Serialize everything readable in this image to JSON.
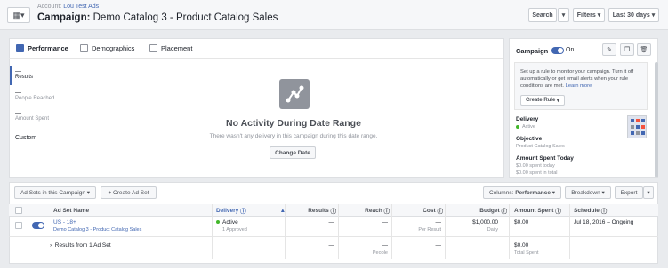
{
  "header": {
    "account_prefix": "Account:",
    "account_name": "Lou Test Ads",
    "title_type": "Campaign:",
    "title_name": "Demo Catalog 3 - Product Catalog Sales",
    "search_label": "Search",
    "filters_label": "Filters",
    "date_label": "Last 30 days"
  },
  "tabs": [
    {
      "label": "Performance"
    },
    {
      "label": "Demographics"
    },
    {
      "label": "Placement"
    }
  ],
  "metrics": {
    "results_value": "—",
    "results_label": "Results",
    "reach_value": "—",
    "reach_label": "People Reached",
    "spent_value": "—",
    "spent_label": "Amount Spent",
    "custom_label": "Custom"
  },
  "empty_state": {
    "title": "No Activity During Date Range",
    "subtitle": "There wasn't any delivery in this campaign during this date range.",
    "button": "Change Date"
  },
  "sidebar": {
    "title": "Campaign",
    "toggle_state": "On",
    "rule_text": "Set up a rule to monitor your campaign. Turn it off automatically or get email alerts when your rule conditions are met.",
    "learn_more": "Learn more",
    "create_rule": "Create Rule",
    "delivery_label": "Delivery",
    "delivery_value": "Active",
    "objective_label": "Objective",
    "objective_value": "Product Catalog Sales",
    "spent_today_label": "Amount Spent Today",
    "spent_today_value": "$0.00 spent today",
    "spent_total_value": "$0.00 spent in total"
  },
  "table_toolbar": {
    "adsets_label": "Ad Sets in this Campaign",
    "create_label": "+ Create Ad Set",
    "columns_label": "Columns:",
    "columns_value": "Performance",
    "breakdown_label": "Breakdown",
    "export_label": "Export"
  },
  "table": {
    "headers": [
      "Ad Set Name",
      "Delivery",
      "Results",
      "Reach",
      "Cost",
      "Budget",
      "Amount Spent",
      "Schedule"
    ],
    "row": {
      "name": "US - 18+",
      "campaign": "Demo Catalog 3 - Product Catalog Sales",
      "delivery": "Active",
      "delivery_sub": "1 Approved",
      "results": "—",
      "reach": "—",
      "cost": "—",
      "cost_sub": "Per Result",
      "budget": "$1,000.00",
      "budget_sub": "Daily",
      "spent": "$0.00",
      "schedule": "Jul 18, 2016 – Ongoing"
    },
    "summary": {
      "label": "Results from 1 Ad Set",
      "results": "—",
      "reach": "—",
      "reach_sub": "People",
      "cost": "—",
      "spent": "$0.00",
      "spent_sub": "Total Spent"
    }
  },
  "colors": {
    "accent": "#4267b2",
    "active": "#42b72a",
    "background": "#e9ebee"
  }
}
